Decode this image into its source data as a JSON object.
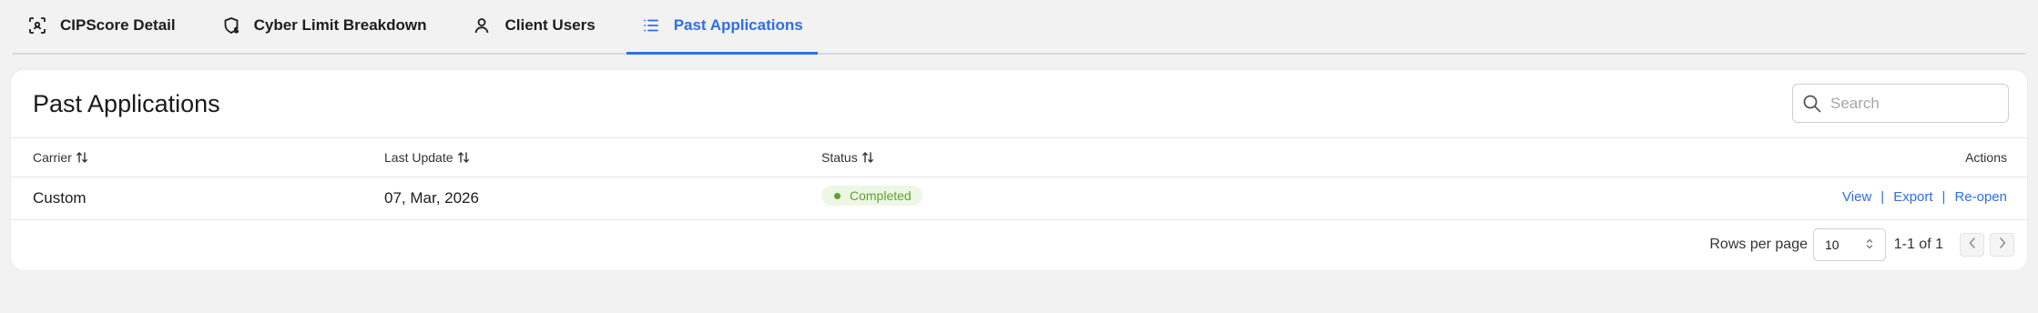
{
  "tabs": [
    {
      "label": "CIPScore Detail",
      "icon": "scan-score-icon",
      "active": false
    },
    {
      "label": "Cyber Limit Breakdown",
      "icon": "shield-dollar-icon",
      "active": false
    },
    {
      "label": "Client Users",
      "icon": "user-icon",
      "active": false
    },
    {
      "label": "Past Applications",
      "icon": "list-icon",
      "active": true
    }
  ],
  "card": {
    "title": "Past Applications",
    "search_placeholder": "Search"
  },
  "table": {
    "columns": {
      "carrier": "Carrier",
      "last_update": "Last Update",
      "status": "Status",
      "actions": "Actions"
    },
    "rows": [
      {
        "carrier": "Custom",
        "last_update": "07, Mar, 2026",
        "status": "Completed",
        "actions": {
          "view": "View",
          "export": "Export",
          "reopen": "Re-open"
        }
      }
    ]
  },
  "pagination": {
    "rows_per_page_label": "Rows per page",
    "rows_per_page_value": "10",
    "range": "1-1 of 1"
  },
  "colors": {
    "accent": "#2f6fe4",
    "status_completed": "#5aa52d",
    "status_completed_bg": "#eef7e6"
  }
}
